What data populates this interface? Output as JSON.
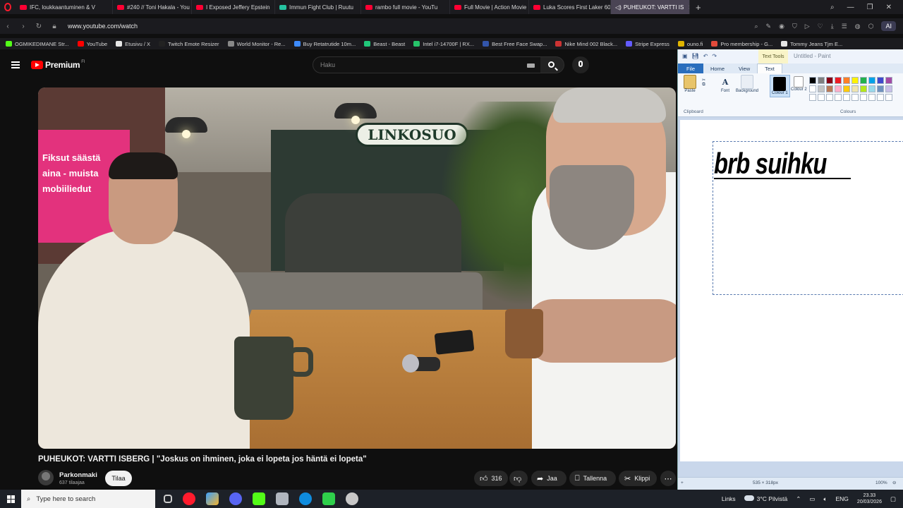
{
  "browser": {
    "tabs": [
      {
        "label": "IFC, loukkaantuminen & V",
        "active": false
      },
      {
        "label": "#240 // Toni Hakala - You",
        "active": false
      },
      {
        "label": "I Exposed Jeffery Epstein",
        "active": false
      },
      {
        "label": "Immun Fight Club | Ruutu",
        "active": false
      },
      {
        "label": "rambo full movie - YouTu",
        "active": false
      },
      {
        "label": "Full Movie | Action Movie",
        "active": false
      },
      {
        "label": "Luka Scores First Laker 60",
        "active": false
      },
      {
        "label": "PUHEUKOT: VARTTI IS",
        "active": true
      }
    ],
    "url": "www.youtube.com/watch",
    "ai_label": "AI",
    "bookmarks": [
      {
        "label": "OGMIKEDIMANE Str...",
        "color": "#53fc18"
      },
      {
        "label": "YouTube",
        "color": "#ff0000"
      },
      {
        "label": "Etusivu / X",
        "color": "#e6e6e6"
      },
      {
        "label": "Twitch Emote Resizer",
        "color": "#222222"
      },
      {
        "label": "World Monitor - Re...",
        "color": "#888888"
      },
      {
        "label": "Buy Retatrutide 10m...",
        "color": "#3d8bfd"
      },
      {
        "label": "Beast - Beast",
        "color": "#21c77a"
      },
      {
        "label": "Intel i7-14700F | RX...",
        "color": "#27c36a"
      },
      {
        "label": "Best Free Face Swap...",
        "color": "#3355aa"
      },
      {
        "label": "Nike Mind 002 Black...",
        "color": "#cc3333"
      },
      {
        "label": "Stripe Express",
        "color": "#635bff"
      },
      {
        "label": "ouno.fi",
        "color": "#e0b400"
      },
      {
        "label": "Pro membership - G...",
        "color": "#e24a3b"
      },
      {
        "label": "Tommy Jeans Tjm E...",
        "color": "#e6e6e6"
      }
    ]
  },
  "youtube": {
    "logo_text": "Premium",
    "country_code": "FI",
    "search_placeholder": "Haku",
    "video": {
      "sign_text": "LINKOSUO",
      "store_text_lines": [
        "Fiksut säästä",
        "aina - muista",
        "mobiiliedut"
      ]
    },
    "title": "PUHEUKOT: VARTTI ISBERG | \"Joskus on ihminen, joka ei lopeta jos häntä ei lopeta\"",
    "channel": {
      "name": "Parkonmaki",
      "subscribers": "637 tilaajaa",
      "subscribe_label": "Tilaa"
    },
    "actions": {
      "likes": "316",
      "share": "Jaa",
      "save": "Tallenna",
      "clip": "Klippi"
    }
  },
  "paint": {
    "context_tab": "Text Tools",
    "window_title": "Untitled - Paint",
    "tabs": [
      "File",
      "Home",
      "View",
      "Text"
    ],
    "groups": {
      "paste": "Paste",
      "font": "Font",
      "background": "Background",
      "colour1": "Colour 1",
      "colour2": "Colour 2"
    },
    "sections": {
      "clipboard": "Clipboard",
      "colours": "Colours"
    },
    "canvas_text": "brb suihku",
    "status_size": "535 × 318px",
    "zoom": "100%",
    "palette": [
      "#000000",
      "#7f7f7f",
      "#880015",
      "#ed1c24",
      "#ff7f27",
      "#fff200",
      "#22b14c",
      "#00a2e8",
      "#3f48cc",
      "#a349a4",
      "#ffffff",
      "#c3c3c3",
      "#b97a57",
      "#ffaec9",
      "#ffc90e",
      "#efe4b0",
      "#b5e61d",
      "#99d9ea",
      "#7092be",
      "#c8bfe7",
      "#ffffff",
      "#ffffff",
      "#ffffff",
      "#ffffff",
      "#ffffff",
      "#ffffff",
      "#ffffff",
      "#ffffff",
      "#ffffff",
      "#ffffff"
    ]
  },
  "taskbar": {
    "search_placeholder": "Type here to search",
    "links_label": "Links",
    "weather": "3°C Pilvistä",
    "lang": "ENG",
    "time": "23.33",
    "date": "20/03/2026"
  }
}
